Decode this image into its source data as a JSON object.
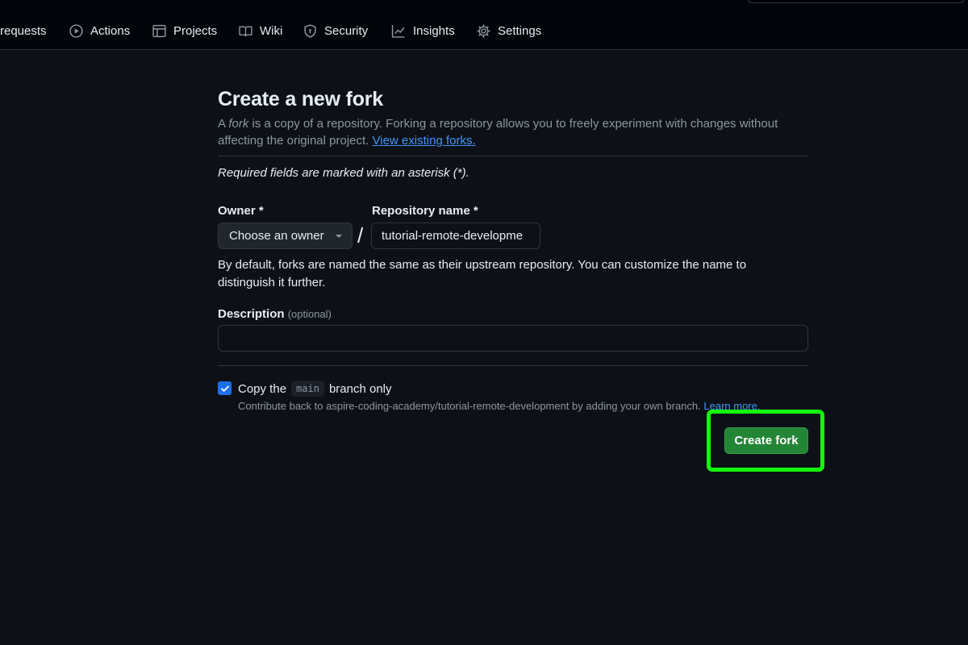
{
  "nav": {
    "items": [
      {
        "label": "requests",
        "icon": "pull-request-icon"
      },
      {
        "label": "Actions",
        "icon": "play-circle-icon"
      },
      {
        "label": "Projects",
        "icon": "table-icon"
      },
      {
        "label": "Wiki",
        "icon": "book-icon"
      },
      {
        "label": "Security",
        "icon": "shield-icon"
      },
      {
        "label": "Insights",
        "icon": "graph-icon"
      },
      {
        "label": "Settings",
        "icon": "gear-icon"
      }
    ]
  },
  "form": {
    "title": "Create a new fork",
    "subtitle_prefix": "A ",
    "subtitle_fork": "fork",
    "subtitle_middle": " is a copy of a repository. Forking a repository allows you to freely experiment with changes without affecting the original project. ",
    "view_forks_link": "View existing forks.",
    "required_note": "Required fields are marked with an asterisk (*).",
    "owner_label": "Owner *",
    "owner_button": "Choose an owner",
    "slash": "/",
    "repo_label": "Repository name *",
    "repo_value": "tutorial-remote-developme",
    "help_text": "By default, forks are named the same as their upstream repository. You can customize the name to distinguish it further.",
    "description_label": "Description",
    "description_optional": "(optional)",
    "description_value": "",
    "copy_prefix": "Copy the",
    "copy_branch": "main",
    "copy_suffix": "branch only",
    "copy_checked": true,
    "contribute_text": "Contribute back to aspire-coding-academy/tutorial-remote-development by adding your own branch.",
    "learn_more": "Learn more.",
    "create_button": "Create fork"
  },
  "colors": {
    "background": "#0d1117",
    "accent_link": "#4493f8",
    "primary_button": "#238636",
    "checkbox": "#1f6feb",
    "highlight": "#14ff0a"
  }
}
